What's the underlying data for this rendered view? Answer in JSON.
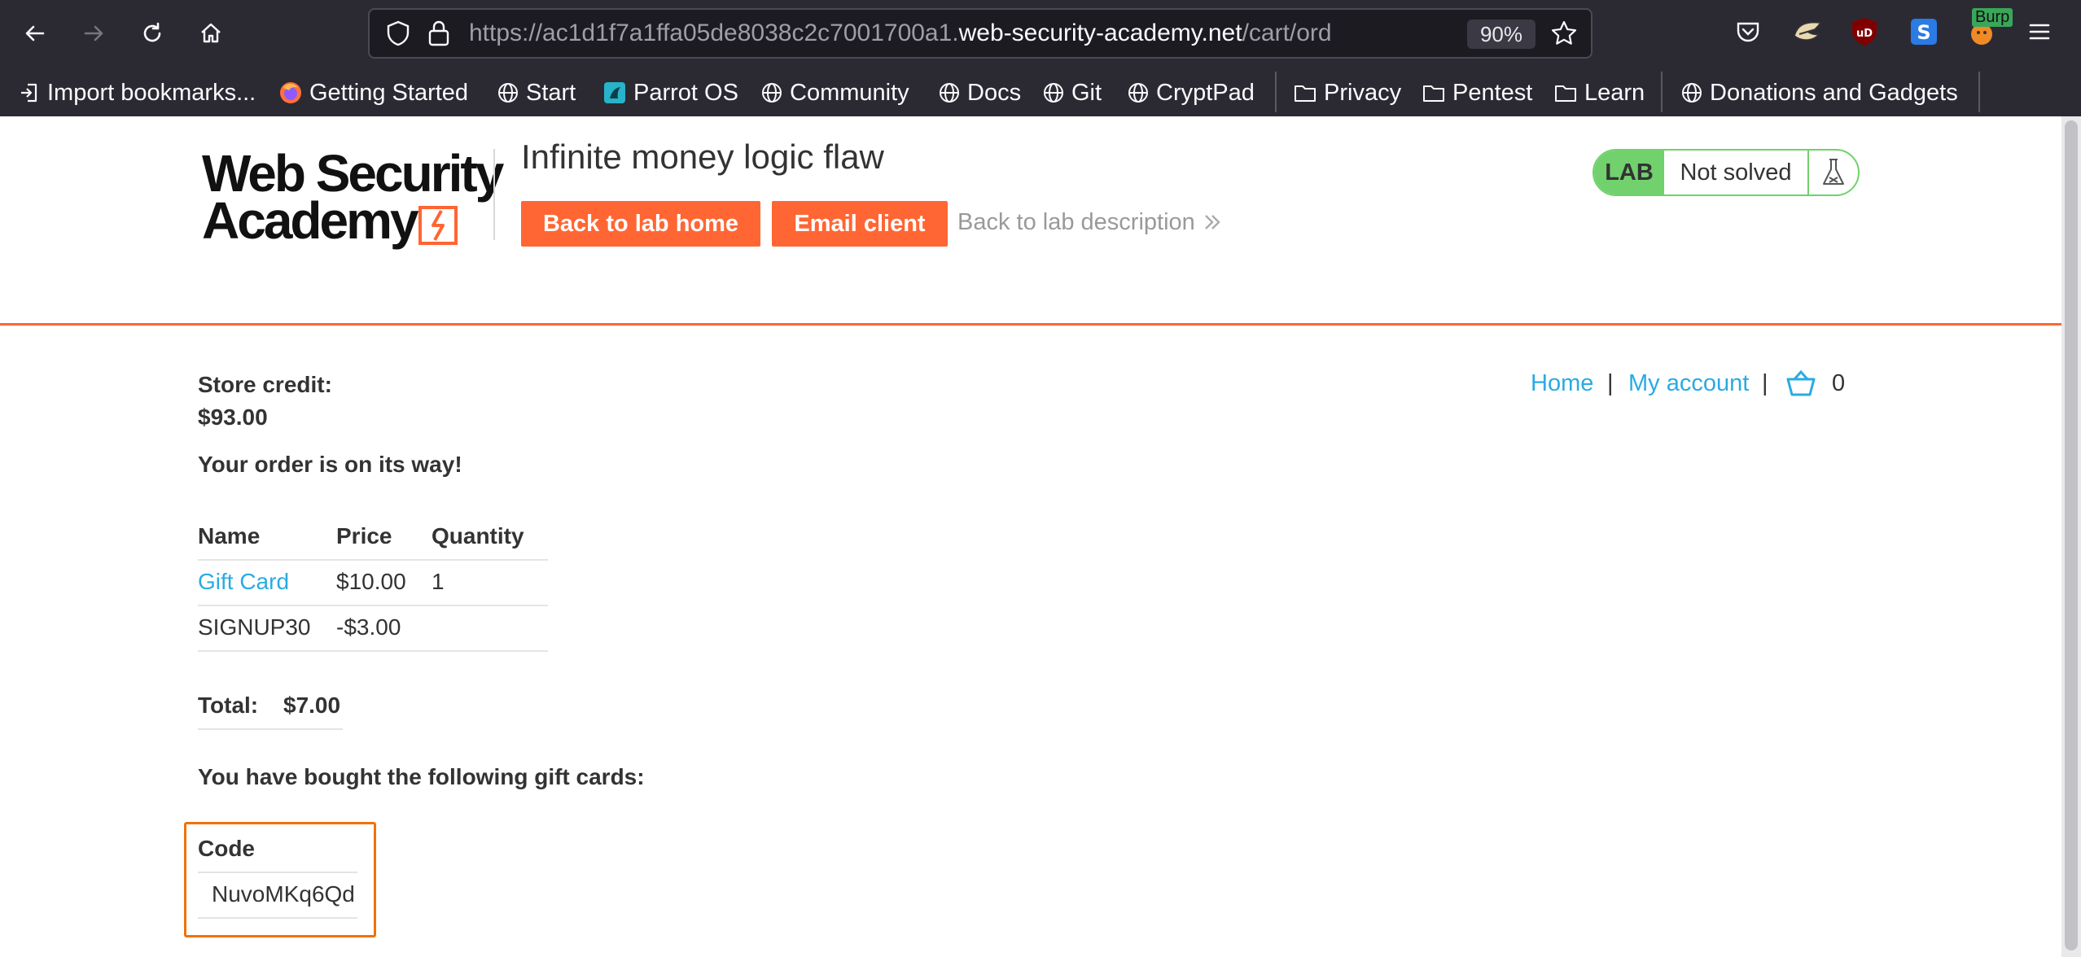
{
  "browser": {
    "url_prefix": "https://ac1d1f7a1ffa05de8038c2c7001700a1.",
    "url_host": "web-security-academy.net",
    "url_path": "/cart/order-con",
    "zoom": "90%",
    "bookmarks": [
      "Import bookmarks...",
      "Getting Started",
      "Start",
      "Parrot OS",
      "Community",
      "Docs",
      "Git",
      "CryptPad",
      "Privacy",
      "Pentest",
      "Learn",
      "Donations and Gadgets"
    ],
    "extension_badge": "Burp"
  },
  "header": {
    "logo_line1": "Web Security",
    "logo_line2": "Academy",
    "lab_title": "Infinite money logic flaw",
    "back_to_lab_home": "Back to lab home",
    "email_client": "Email client",
    "back_to_description": "Back to lab description",
    "lab_label": "LAB",
    "lab_status": "Not solved"
  },
  "nav": {
    "home": "Home",
    "separator": "|",
    "my_account": "My account",
    "cart_count": "0"
  },
  "account": {
    "store_credit_label": "Store credit:",
    "store_credit_value": "$93.00",
    "order_message": "Your order is on its way!"
  },
  "order_table": {
    "headers": [
      "Name",
      "Price",
      "Quantity"
    ],
    "rows": [
      {
        "name": "Gift Card",
        "price": "$10.00",
        "quantity": "1"
      },
      {
        "name": "SIGNUP30",
        "price": "-$3.00",
        "quantity": ""
      }
    ]
  },
  "total": {
    "label": "Total:",
    "value": "$7.00"
  },
  "gift_cards": {
    "heading": "You have bought the following gift cards:",
    "column_header": "Code",
    "codes": [
      "NuvoMKq6Qd"
    ]
  },
  "colors": {
    "brand_orange": "#ff6633",
    "link_blue": "#29abe2",
    "lab_green": "#70d16d",
    "highlight_box": "#f0720a"
  }
}
